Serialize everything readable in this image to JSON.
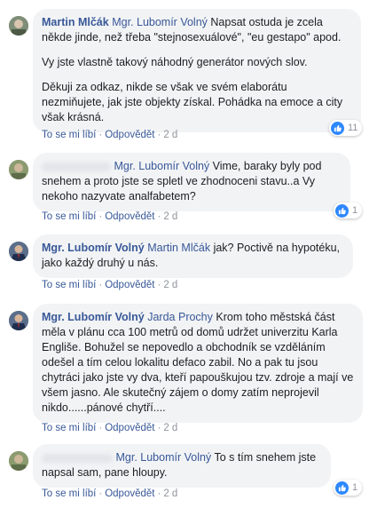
{
  "actions": {
    "like": "To se mi líbí",
    "reply": "Odpovědět",
    "separator": "·"
  },
  "comments": [
    {
      "author": "Martin Mlčák",
      "mention": "Mgr. Lubomír Volný",
      "paragraphs": [
        "Napsat ostuda je zcela někde jinde, než třeba \"stejnosexuálové\", \"eu gestapo\" apod.",
        "Vy jste vlastně takový náhodný generátor nových slov.",
        "Děkuji za odkaz, nikde se však ve svém elaborátu nezmiňujete, jak jste objekty získal. Pohádka na emoce a city však krásná."
      ],
      "time": "2 d",
      "reactions": "11"
    },
    {
      "author": "",
      "mention": "Mgr. Lubomír Volný",
      "paragraphs": [
        "Vime, baraky byly pod snehem a proto jste se spletl ve zhodnoceni stavu..a Vy nekoho nazyvate analfabetem?"
      ],
      "time": "2 d",
      "reactions": "1"
    },
    {
      "author": "Mgr. Lubomír Volný",
      "mention": "Martin Mlčák",
      "paragraphs": [
        "jak? Poctivě na hypotéku, jako každý druhý u nás."
      ],
      "time": "2 d",
      "reactions": ""
    },
    {
      "author": "Mgr. Lubomír Volný",
      "mention": "Jarda Prochy",
      "paragraphs": [
        "Krom toho městská část měla v plánu cca 100 metrů od domů udržet univerzitu Karla Engliše. Bohužel se nepovedlo a obchodník se vzděláním odešel a tím celou lokalitu defaco zabil. No a pak tu jsou chytráci jako jste vy dva, kteří papouškujou tzv. zdroje a mají ve všem jasno. Ale skutečný zájem o domy zatím neprojevil nikdo......pánové chytří...."
      ],
      "time": "2 d",
      "reactions": ""
    },
    {
      "author": "",
      "mention": "Mgr. Lubomír Volný",
      "paragraphs": [
        "To s tím snehem jste napsal sam, pane hloupy."
      ],
      "time": "2 d",
      "reactions": "1"
    }
  ]
}
